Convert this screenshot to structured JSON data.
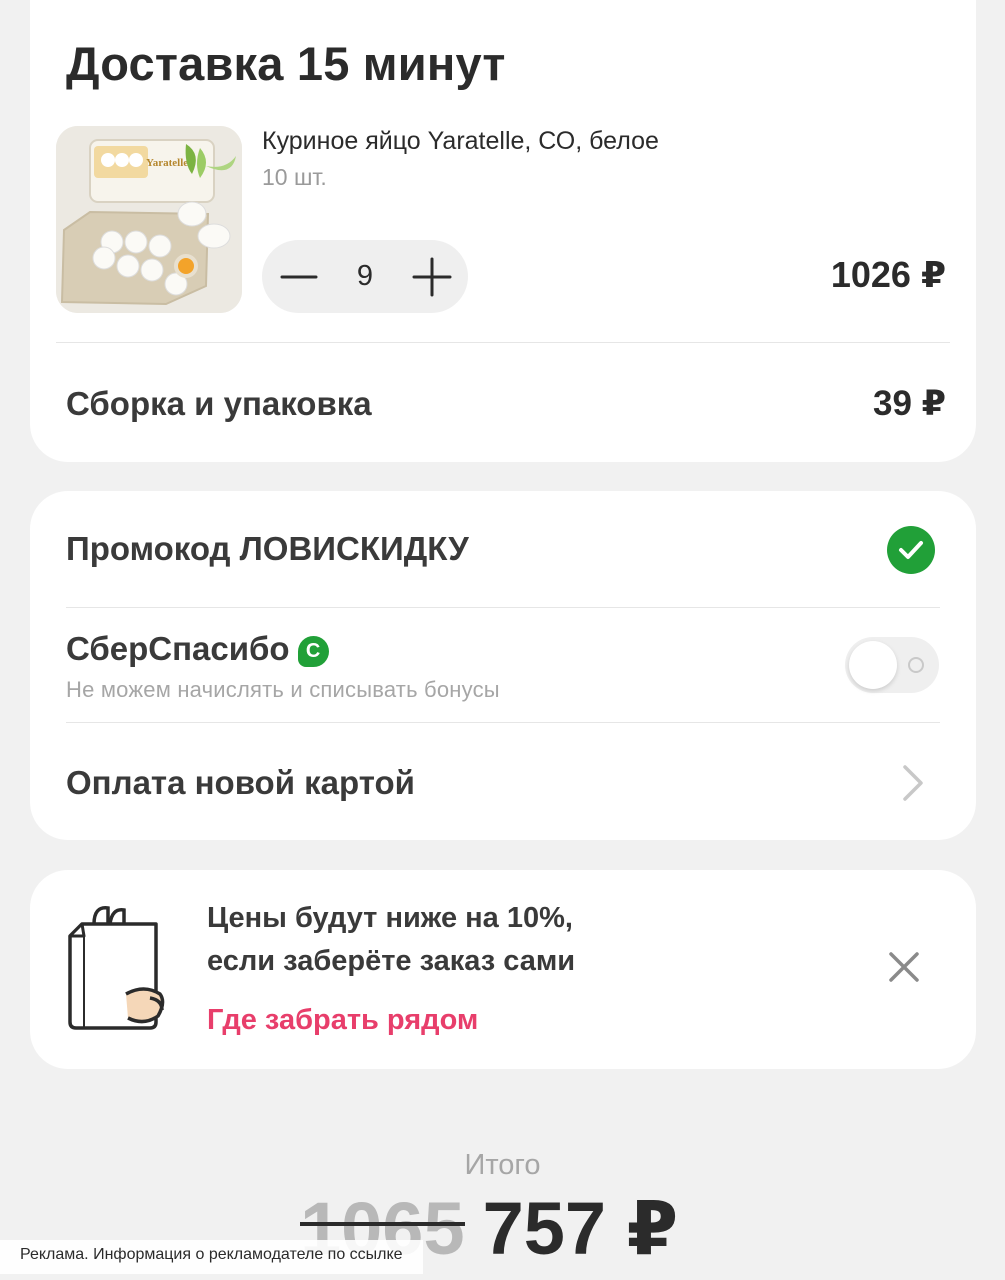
{
  "delivery": {
    "title": "Доставка 15 минут",
    "product": {
      "name": "Куриное яйцо Yaratelle, СО, белое",
      "unit": "10 шт.",
      "image_brand_text": "Yaratelle",
      "quantity": "9",
      "price": "1026 ₽"
    },
    "assembly": {
      "label": "Сборка и упаковка",
      "price": "39 ₽"
    }
  },
  "payment": {
    "promo_label": "Промокод ЛОВИСКИДКУ",
    "promo_applied": true,
    "sber_label": "СберСпасибо",
    "sber_badge": "С",
    "sber_note": "Не можем начислять и списывать бонусы",
    "sber_toggle_on": false,
    "card_label": "Оплата новой картой"
  },
  "pickup": {
    "line1": "Цены будут ниже на 10%,",
    "line2": "если заберёте заказ сами",
    "link": "Где забрать рядом"
  },
  "total": {
    "label": "Итого",
    "old": "1065",
    "new": "757 ₽"
  },
  "ad_note": "Реклама. Информация о рекламодателе по ссылке",
  "colors": {
    "accent_green": "#21a038",
    "link_pink": "#e83e6b",
    "background": "#f1f1f1"
  },
  "icons": [
    "minus-icon",
    "plus-icon",
    "check-icon",
    "sber-icon",
    "chevron-right-icon",
    "paper-bag-icon",
    "close-icon"
  ]
}
